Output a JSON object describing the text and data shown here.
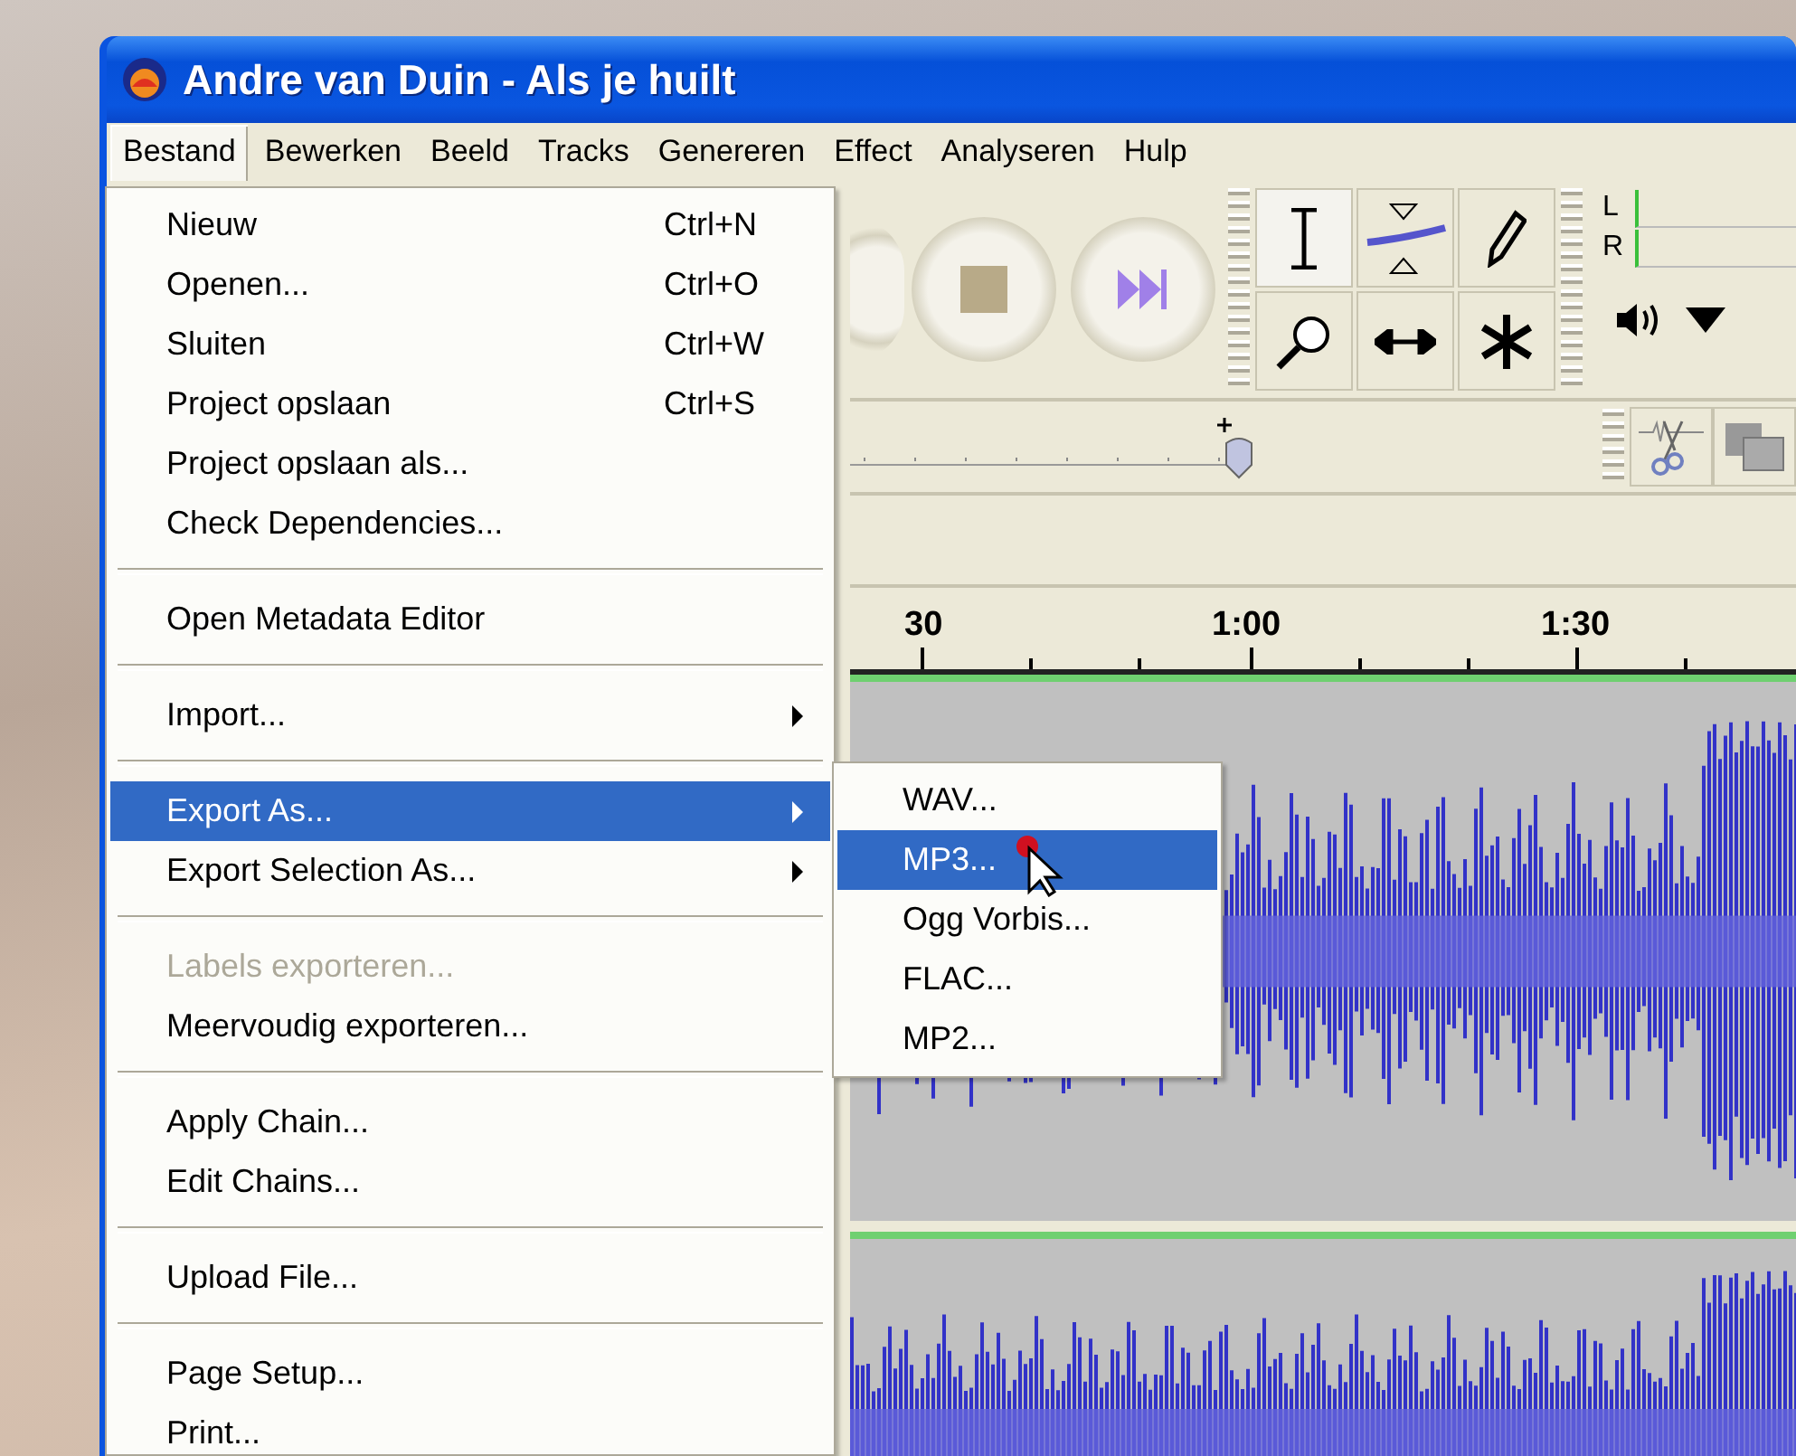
{
  "window": {
    "title": "Andre van Duin - Als je huilt"
  },
  "menu_bar": [
    {
      "label": "Bestand",
      "selected": true
    },
    {
      "label": "Bewerken",
      "selected": false
    },
    {
      "label": "Beeld",
      "selected": false
    },
    {
      "label": "Tracks",
      "selected": false
    },
    {
      "label": "Genereren",
      "selected": false
    },
    {
      "label": "Effect",
      "selected": false
    },
    {
      "label": "Analyseren",
      "selected": false
    },
    {
      "label": "Hulp",
      "selected": false
    }
  ],
  "file_menu": {
    "groups": [
      [
        {
          "label": "Nieuw",
          "shortcut": "Ctrl+N",
          "has_submenu": false,
          "selected": false,
          "disabled": false
        },
        {
          "label": "Openen...",
          "shortcut": "Ctrl+O",
          "has_submenu": false,
          "selected": false,
          "disabled": false
        },
        {
          "label": "Sluiten",
          "shortcut": "Ctrl+W",
          "has_submenu": false,
          "selected": false,
          "disabled": false
        },
        {
          "label": "Project opslaan",
          "shortcut": "Ctrl+S",
          "has_submenu": false,
          "selected": false,
          "disabled": false
        },
        {
          "label": "Project opslaan als...",
          "has_submenu": false,
          "selected": false,
          "disabled": false
        },
        {
          "label": "Check Dependencies...",
          "has_submenu": false,
          "selected": false,
          "disabled": false
        }
      ],
      [
        {
          "label": "Open Metadata Editor",
          "has_submenu": false,
          "selected": false,
          "disabled": false
        }
      ],
      [
        {
          "label": "Import...",
          "has_submenu": true,
          "selected": false,
          "disabled": false
        }
      ],
      [
        {
          "label": "Export As...",
          "has_submenu": true,
          "selected": true,
          "disabled": false
        },
        {
          "label": "Export Selection As...",
          "has_submenu": true,
          "selected": false,
          "disabled": false
        }
      ],
      [
        {
          "label": "Labels exporteren...",
          "has_submenu": false,
          "selected": false,
          "disabled": true
        },
        {
          "label": "Meervoudig exporteren...",
          "has_submenu": false,
          "selected": false,
          "disabled": false
        }
      ],
      [
        {
          "label": "Apply Chain...",
          "has_submenu": false,
          "selected": false,
          "disabled": false
        },
        {
          "label": "Edit Chains...",
          "has_submenu": false,
          "selected": false,
          "disabled": false
        }
      ],
      [
        {
          "label": "Upload File...",
          "has_submenu": false,
          "selected": false,
          "disabled": false
        }
      ],
      [
        {
          "label": "Page Setup...",
          "has_submenu": false,
          "selected": false,
          "disabled": false
        },
        {
          "label": "Print...",
          "has_submenu": false,
          "selected": false,
          "disabled": false
        }
      ]
    ]
  },
  "export_submenu": [
    {
      "label": "WAV...",
      "selected": false
    },
    {
      "label": "MP3...",
      "selected": true
    },
    {
      "label": "Ogg Vorbis...",
      "selected": false
    },
    {
      "label": "FLAC...",
      "selected": false
    },
    {
      "label": "MP2...",
      "selected": false
    }
  ],
  "meter": {
    "channels": [
      "L",
      "R"
    ]
  },
  "ruler": {
    "labels": [
      "30",
      "1:00",
      "1:30"
    ]
  }
}
